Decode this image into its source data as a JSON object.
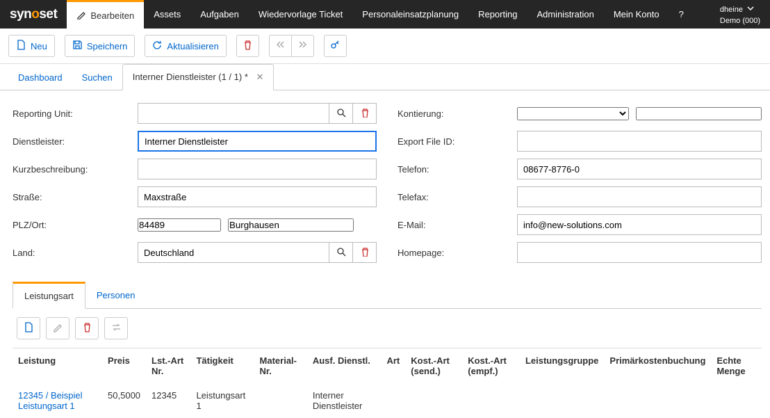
{
  "brand": {
    "part1": "syn",
    "part2": "o",
    "part3": "set"
  },
  "nav": {
    "items": [
      {
        "label": "Bearbeiten",
        "active": true
      },
      {
        "label": "Assets"
      },
      {
        "label": "Aufgaben"
      },
      {
        "label": "Wiedervorlage Ticket"
      },
      {
        "label": "Personaleinsatzplanung"
      },
      {
        "label": "Reporting"
      },
      {
        "label": "Administration"
      },
      {
        "label": "Mein Konto"
      },
      {
        "label": "?"
      }
    ],
    "user": {
      "name": "dheine",
      "org": "Demo (000)"
    }
  },
  "toolbar": {
    "new_label": "Neu",
    "save_label": "Speichern",
    "refresh_label": "Aktualisieren"
  },
  "tabs": {
    "items": [
      {
        "label": "Dashboard"
      },
      {
        "label": "Suchen"
      },
      {
        "label": "Interner Dienstleister (1 / 1) *",
        "active": true,
        "closable": true
      }
    ]
  },
  "form": {
    "left": {
      "reporting_unit": {
        "label": "Reporting Unit:",
        "value": ""
      },
      "dienstleister": {
        "label": "Dienstleister:",
        "value": "Interner Dienstleister"
      },
      "kurzbeschreibung": {
        "label": "Kurzbeschreibung:",
        "value": ""
      },
      "strasse": {
        "label": "Straße:",
        "value": "Maxstraße"
      },
      "plzort": {
        "label": "PLZ/Ort:",
        "plz": "84489",
        "ort": "Burghausen"
      },
      "land": {
        "label": "Land:",
        "value": "Deutschland"
      }
    },
    "right": {
      "kontierung": {
        "label": "Kontierung:",
        "select": "",
        "value": ""
      },
      "export_file_id": {
        "label": "Export File ID:",
        "value": ""
      },
      "telefon": {
        "label": "Telefon:",
        "value": "08677-8776-0"
      },
      "telefax": {
        "label": "Telefax:",
        "value": ""
      },
      "email": {
        "label": "E-Mail:",
        "value": "info@new-solutions.com"
      },
      "homepage": {
        "label": "Homepage:",
        "value": ""
      }
    }
  },
  "subtabs": {
    "items": [
      {
        "label": "Leistungsart",
        "active": true
      },
      {
        "label": "Personen"
      }
    ]
  },
  "table": {
    "headers": [
      "Leistung",
      "Preis",
      "Lst.-Art Nr.",
      "Tätigkeit",
      "Material-Nr.",
      "Ausf. Dienstl.",
      "Art",
      "Kost.-Art (send.)",
      "Kost.-Art (empf.)",
      "Leistungsgruppe",
      "Primärkostenbuchung",
      "Echte Menge"
    ],
    "rows": [
      {
        "leistung": "12345 / Beispiel Leistungsart 1",
        "preis": "50,5000",
        "lstnr": "12345",
        "taetigkeit": "Leistungsart 1",
        "materialnr": "",
        "ausf": "Interner Dienstleister",
        "art": "",
        "kost_send": "",
        "kost_empf": "",
        "gruppe": "",
        "primaer": "",
        "echte": ""
      }
    ]
  }
}
